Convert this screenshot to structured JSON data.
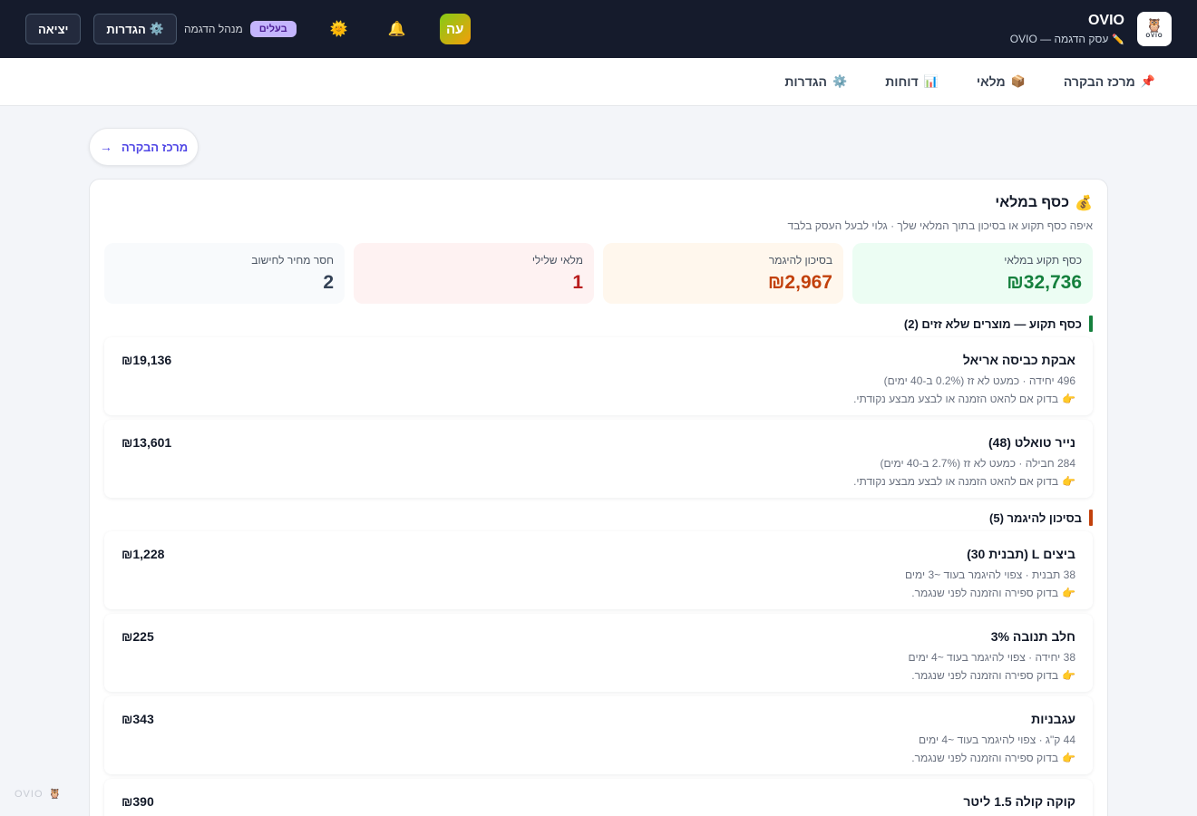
{
  "app": {
    "name": "OVIO",
    "business": "עסק הדגמה — OVIO",
    "logo_text": "OVIO"
  },
  "topbar": {
    "avatar_letter": "עה",
    "role_badge": "בעלים",
    "role_name": "מנהל הדגמה",
    "settings_label": "הגדרות",
    "logout_label": "יציאה"
  },
  "nav": {
    "items": [
      {
        "icon": "📌",
        "label": "מרכז הבקרה"
      },
      {
        "icon": "📦",
        "label": "מלאי"
      },
      {
        "icon": "📊",
        "label": "דוחות"
      },
      {
        "icon": "⚙️",
        "label": "הגדרות"
      }
    ]
  },
  "back": {
    "label": "מרכז הבקרה",
    "arrow": "→"
  },
  "card": {
    "icon": "💰",
    "title": "כסף במלאי",
    "subtitle": "איפה כסף תקוע או בסיכון בתוך המלאי שלך · גלוי לבעל העסק בלבד",
    "stats": [
      {
        "label": "כסף תקוע במלאי",
        "value": "₪32,736",
        "tone": "green"
      },
      {
        "label": "בסיכון להיגמר",
        "value": "₪2,967",
        "tone": "orange"
      },
      {
        "label": "מלאי שלילי",
        "value": "1",
        "tone": "red"
      },
      {
        "label": "חסר מחיר לחישוב",
        "value": "2",
        "tone": "gray"
      }
    ],
    "sections": [
      {
        "title": "כסף תקוע — מוצרים שלא זזים (2)",
        "tone": "green",
        "items": [
          {
            "name": "אבקת כביסה אריאל",
            "meta": "496 יחידה · כמעט לא זז (0.2% ב-40 ימים)",
            "tip_icon": "👉",
            "tip": "בדוק אם להאט הזמנה או לבצע מבצע נקודתי.",
            "amount": "₪19,136"
          },
          {
            "name": "נייר טואלט (48)",
            "meta": "284 חבילה · כמעט לא זז (2.7% ב-40 ימים)",
            "tip_icon": "👉",
            "tip": "בדוק אם להאט הזמנה או לבצע מבצע נקודתי.",
            "amount": "₪13,601"
          }
        ]
      },
      {
        "title": "בסיכון להיגמר (5)",
        "tone": "red",
        "items": [
          {
            "name": "ביצים L (תבנית 30)",
            "meta": "38 תבנית · צפוי להיגמר בעוד ~3 ימים",
            "tip_icon": "👉",
            "tip": "בדוק ספירה והזמנה לפני שנגמר.",
            "amount": "₪1,228"
          },
          {
            "name": "חלב תנובה 3%",
            "meta": "38 יחידה · צפוי להיגמר בעוד ~4 ימים",
            "tip_icon": "👉",
            "tip": "בדוק ספירה והזמנה לפני שנגמר.",
            "amount": "₪225"
          },
          {
            "name": "עגבניות",
            "meta": "44 ק\"ג · צפוי להיגמר בעוד ~4 ימים",
            "tip_icon": "👉",
            "tip": "בדוק ספירה והזמנה לפני שנגמר.",
            "amount": "₪343"
          },
          {
            "name": "קוקה קולה 1.5 ליטר",
            "meta": "",
            "tip_icon": "",
            "tip": "",
            "amount": "₪390"
          }
        ]
      }
    ]
  },
  "watermark": {
    "text": "OVIO"
  },
  "colors": {
    "topbar": "#151b2c",
    "accent": "#4f46e5",
    "green": "#15803d",
    "orange": "#c2410c",
    "red": "#b91c1c"
  }
}
